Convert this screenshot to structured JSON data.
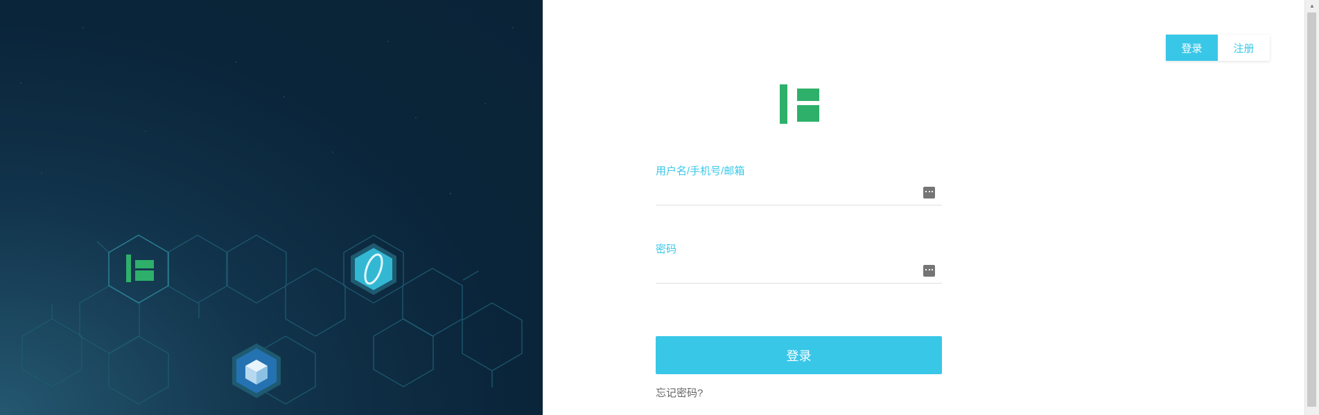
{
  "auth_tabs": {
    "login": "登录",
    "register": "注册"
  },
  "login_form": {
    "username_label": "用户名/手机号/邮箱",
    "username_value": "",
    "password_label": "密码",
    "password_value": "",
    "submit_label": "登录",
    "forgot_label": "忘记密码?"
  },
  "icons": {
    "brand_logo": "green-bars-logo-icon",
    "password_manager": "key-icon",
    "hex_ring_logo": "ring-icon",
    "hex_cube_logo": "cube-icon"
  },
  "colors": {
    "accent": "#39c7e8",
    "brand_green": "#2eb06a",
    "left_background": "#0b2337",
    "hex_stroke": "#1e5a70"
  }
}
